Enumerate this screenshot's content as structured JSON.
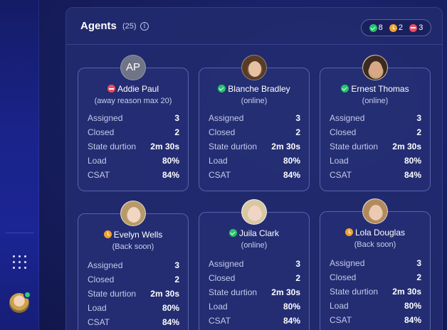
{
  "panel": {
    "title": "Agents",
    "count": "(25)",
    "info_icon": "info-icon",
    "summary": {
      "online": "8",
      "away": "2",
      "busy": "3"
    }
  },
  "colors": {
    "online": "#24c36b",
    "away": "#f0a232",
    "busy": "#ef4e64"
  },
  "stat_labels": {
    "assigned": "Assigned",
    "closed": "Closed",
    "state": "State durtion",
    "load": "Load",
    "csat": "CSAT"
  },
  "agents": [
    {
      "name": "Addie Paul",
      "initials": "AP",
      "status": "busy",
      "substatus": "(away reason max 20)",
      "assigned": "3",
      "closed": "2",
      "state": "2m 30s",
      "load": "80%",
      "csat": "84%"
    },
    {
      "name": "Blanche Bradley",
      "status": "online",
      "substatus": "(online)",
      "assigned": "3",
      "closed": "2",
      "state": "2m 30s",
      "load": "80%",
      "csat": "84%"
    },
    {
      "name": "Ernest Thomas",
      "status": "online",
      "substatus": "(online)",
      "assigned": "3",
      "closed": "2",
      "state": "2m 30s",
      "load": "80%",
      "csat": "84%"
    },
    {
      "name": "Evelyn Wells",
      "status": "away",
      "substatus": "(Back soon)",
      "assigned": "3",
      "closed": "2",
      "state": "2m 30s",
      "load": "80%",
      "csat": "84%"
    },
    {
      "name": "Juila Clark",
      "status": "online",
      "substatus": "(online)",
      "assigned": "3",
      "closed": "2",
      "state": "2m 30s",
      "load": "80%",
      "csat": "84%"
    },
    {
      "name": "Lola Douglas",
      "status": "away",
      "substatus": "(Back soon)",
      "assigned": "3",
      "closed": "2",
      "state": "2m 30s",
      "load": "80%",
      "csat": "84%"
    }
  ],
  "sidebar": {
    "apps_icon": "grid-dots-icon",
    "user_avatar_status": "online"
  }
}
